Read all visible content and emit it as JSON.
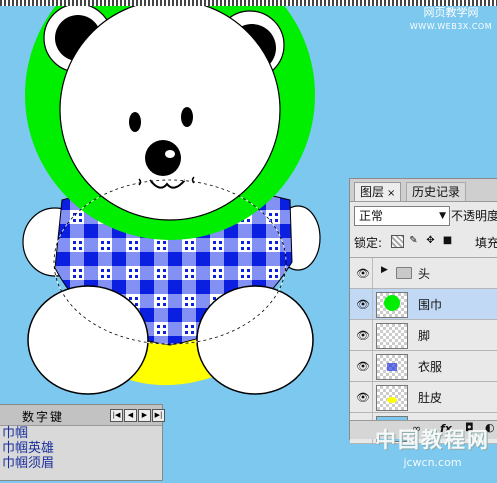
{
  "watermark_top": {
    "line1": "网页教学网",
    "line2": "WWW.WEB3X.COM"
  },
  "layers_panel": {
    "tabs": {
      "active": "图层",
      "close": "×",
      "other": "历史记录"
    },
    "blend_mode": "正常",
    "opacity_label": "不透明度",
    "lock_label": "锁定:",
    "fill_label": "填充",
    "layers": [
      {
        "name": "头",
        "type": "group",
        "visible": true,
        "selected": false
      },
      {
        "name": "围巾",
        "type": "layer",
        "visible": true,
        "selected": true
      },
      {
        "name": "脚",
        "type": "layer",
        "visible": true,
        "selected": false
      },
      {
        "name": "衣服",
        "type": "layer",
        "visible": true,
        "selected": false
      },
      {
        "name": "肚皮",
        "type": "layer",
        "visible": true,
        "selected": false
      }
    ],
    "bottom_fx": "fx"
  },
  "mini_panel": {
    "title": "数字键",
    "lines": [
      "巾帼",
      "巾帼英雄",
      "巾帼须眉"
    ]
  },
  "watermark_bottom": {
    "line1": "中国教程网",
    "line2": "jcwcn.com"
  },
  "colors": {
    "background": "#7cc8ee",
    "scarf": "#00ee00",
    "shirt": "#0a1fe0",
    "pants": "#ffff00",
    "bear": "#ffffff"
  }
}
